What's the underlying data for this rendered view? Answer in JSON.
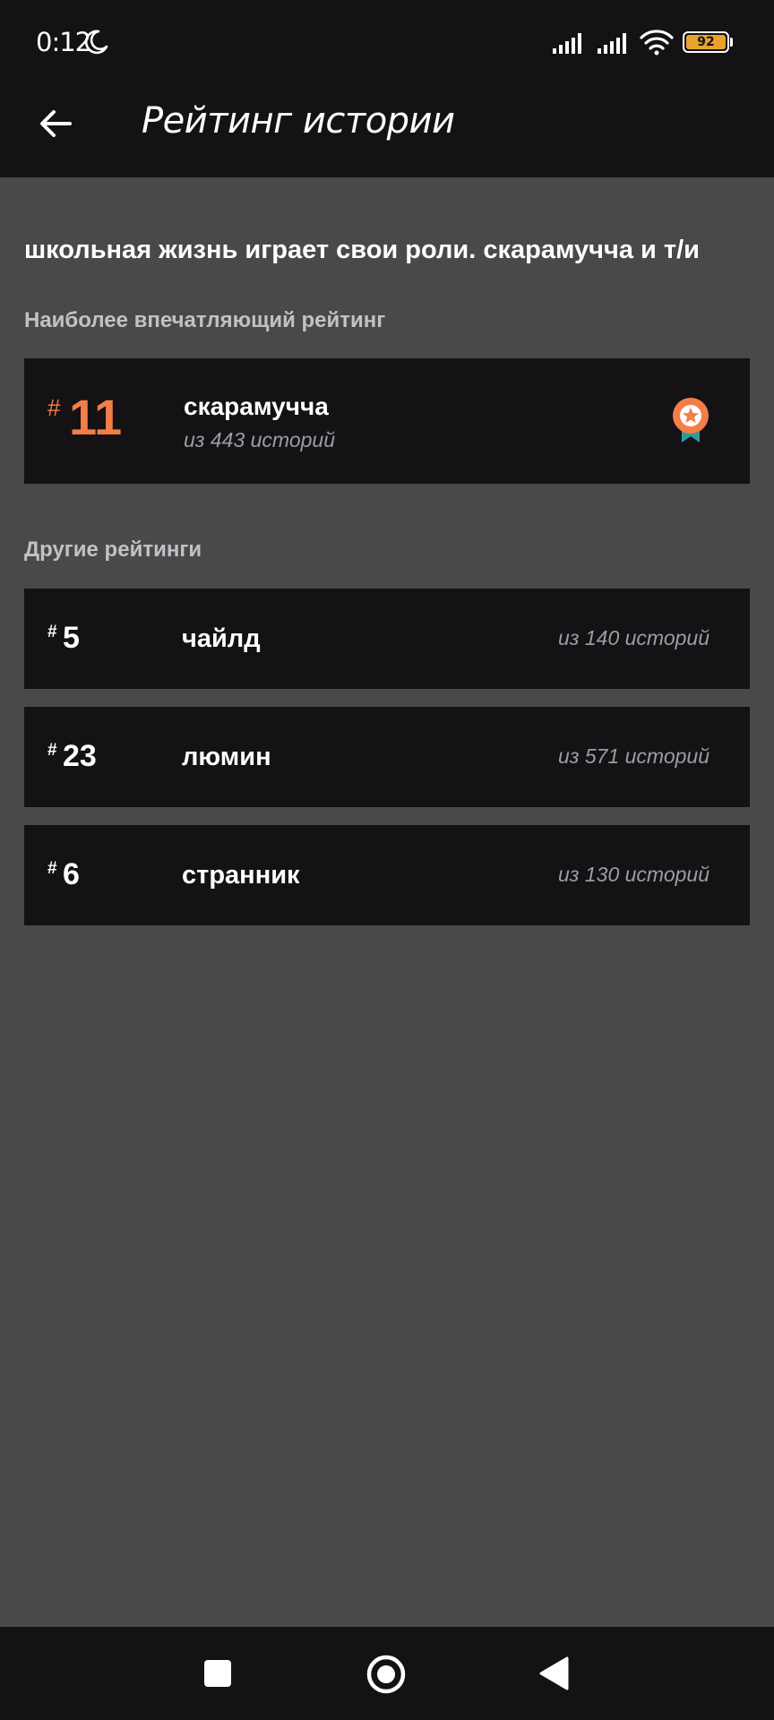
{
  "status_bar": {
    "time": "0:12",
    "battery_level": "92",
    "battery_color": "#e8a32c"
  },
  "app_bar": {
    "title": "Рейтинг истории",
    "back_icon": "arrow-left-icon"
  },
  "story": {
    "title": "школьная жизнь играет свои роли. скарамучча и т/и"
  },
  "featured_section": {
    "label": "Наиболее впечатляющий рейтинг",
    "item": {
      "hash": "#",
      "rank": "11",
      "name": "скарамучча",
      "count": "из 443 историй",
      "accent_color": "#f47e47",
      "icon": "medal-icon"
    }
  },
  "other_section": {
    "label": "Другие рейтинги",
    "items": [
      {
        "hash": "#",
        "rank": "5",
        "name": "чайлд",
        "count": "из 140 историй"
      },
      {
        "hash": "#",
        "rank": "23",
        "name": "люмин",
        "count": "из 571 историй"
      },
      {
        "hash": "#",
        "rank": "6",
        "name": "странник",
        "count": "из 130 историй"
      }
    ]
  },
  "nav_bar": {
    "recents_icon": "square-icon",
    "home_icon": "circle-icon",
    "back_icon": "triangle-back-icon"
  },
  "colors": {
    "background": "#4a484b",
    "surface": "#141215",
    "accent": "#f47e47",
    "medal_ribbon": "#2f9b9a"
  }
}
